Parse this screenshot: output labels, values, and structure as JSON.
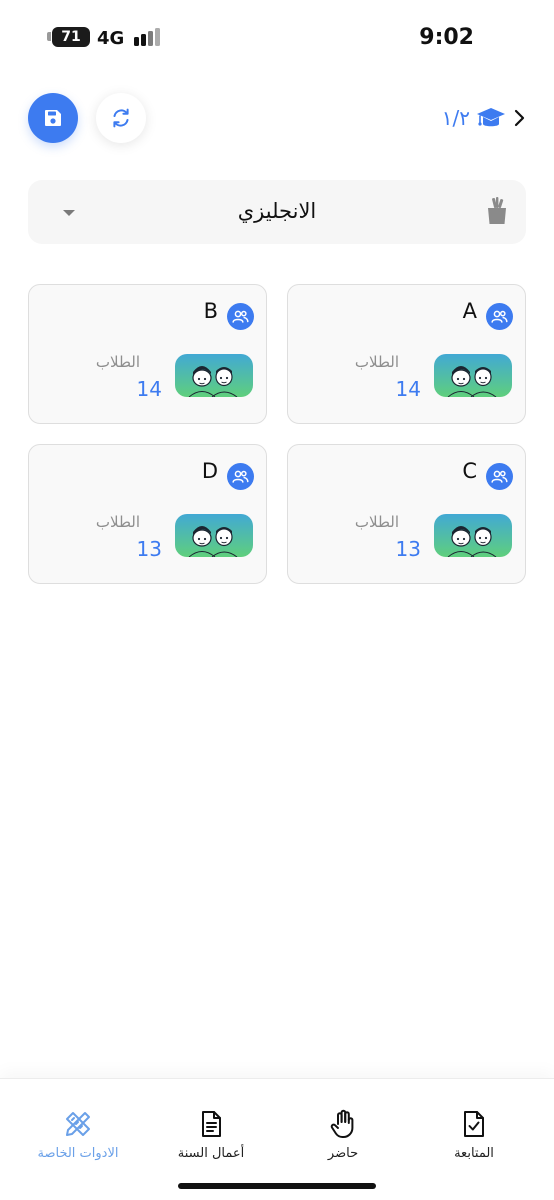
{
  "status_bar": {
    "battery": "71",
    "network": "4G",
    "time": "9:02"
  },
  "header": {
    "save_icon": "floppy-disk-icon",
    "refresh_icon": "sync-icon",
    "class_label": "١/٢",
    "class_icon": "graduation-cap-icon",
    "back_icon": "chevron-right-icon"
  },
  "subject": {
    "selected": "الانجليزي",
    "icon": "pencil-cup-icon"
  },
  "cards": [
    {
      "name": "A",
      "students_label": "الطلاب",
      "count": "14"
    },
    {
      "name": "B",
      "students_label": "الطلاب",
      "count": "14"
    },
    {
      "name": "C",
      "students_label": "الطلاب",
      "count": "13"
    },
    {
      "name": "D",
      "students_label": "الطلاب",
      "count": "13"
    }
  ],
  "tabs": [
    {
      "label": "المتابعة",
      "icon": "document-check-icon"
    },
    {
      "label": "حاضر",
      "icon": "raised-hand-icon"
    },
    {
      "label": "أعمال السنة",
      "icon": "document-lines-icon"
    },
    {
      "label": "الادوات الخاصة",
      "icon": "ruler-pencil-icon"
    }
  ],
  "colors": {
    "accent": "#3d7bf0",
    "active_tab": "#6aa0e8",
    "card_bg": "#f9f9f9",
    "field_bg": "#f6f6f6"
  }
}
